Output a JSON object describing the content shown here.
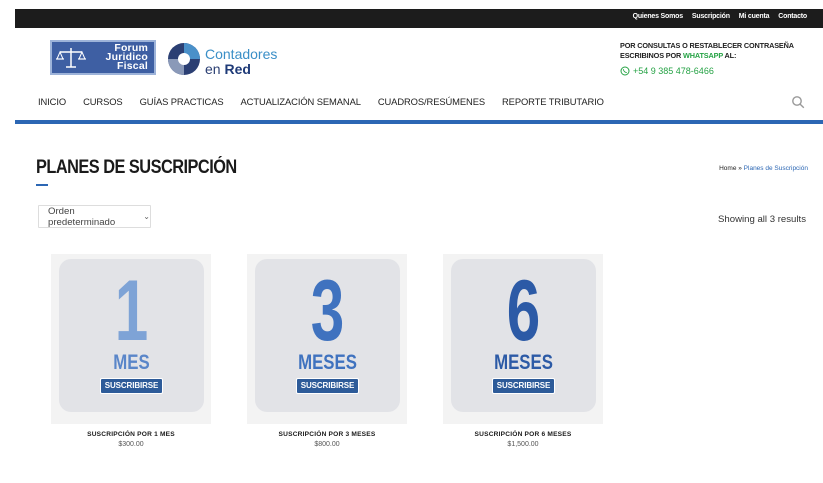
{
  "topbar": {
    "links": [
      "Quienes Somos",
      "Suscripción",
      "Mi cuenta",
      "Contacto"
    ]
  },
  "logos": {
    "forum": [
      "Forum",
      "Juridico",
      "Fiscal"
    ],
    "red_top": "Contadores",
    "red_prefix": "en ",
    "red_bold": "Red"
  },
  "contact": {
    "line1": "POR CONSULTAS O RESTABLECER CONTRASEÑA",
    "line2_pre": "ESCRIBINOS POR ",
    "line2_wa": "WHATSAPP",
    "line2_post": " AL:",
    "phone": "+54 9 385 478-6466",
    "whatsapp_color": "#25a244"
  },
  "nav": [
    "INICIO",
    "CURSOS",
    "GUÍAS PRACTICAS",
    "ACTUALIZACIÓN SEMANAL",
    "CUADROS/RESÚMENES",
    "REPORTE TRIBUTARIO"
  ],
  "page": {
    "title": "PLANES DE SUSCRIPCIÓN",
    "breadcrumb_home": "Home",
    "breadcrumb_sep": " » ",
    "breadcrumb_current": "Planes de Suscripción",
    "order_label": "Orden predeterminado",
    "results": "Showing all 3 results",
    "accent": "#2c67b4"
  },
  "products": [
    {
      "number": "1",
      "unit": "MES",
      "button": "SUSCRIBIRSE",
      "name": "SUSCRIPCIÓN POR 1 MES",
      "price": "$300.00",
      "num_color": "#7ea3d6",
      "unit_color": "#5a86c9"
    },
    {
      "number": "3",
      "unit": "MESES",
      "button": "SUSCRIBIRSE",
      "name": "SUSCRIPCIÓN POR 3 MESES",
      "price": "$800.00",
      "num_color": "#3f72bf",
      "unit_color": "#3f72bf"
    },
    {
      "number": "6",
      "unit": "MESES",
      "button": "SUSCRIBIRSE",
      "name": "SUSCRIPCIÓN POR 6 MESES",
      "price": "$1,500.00",
      "num_color": "#2c5aa6",
      "unit_color": "#2c5aa6"
    }
  ]
}
